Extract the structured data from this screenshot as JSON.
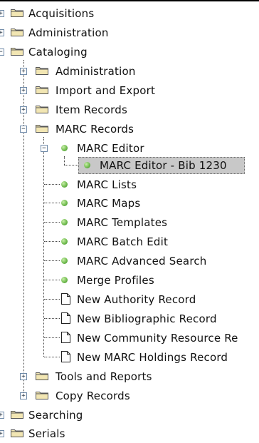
{
  "tree": {
    "items": [
      {
        "label": "Acquisitions",
        "icon": "folder-icon",
        "expander": "+"
      },
      {
        "label": "Administration",
        "icon": "folder-icon",
        "expander": "+"
      },
      {
        "label": "Cataloging",
        "icon": "folder-icon",
        "expander": "-"
      },
      {
        "label": "Administration",
        "icon": "folder-icon",
        "expander": "+"
      },
      {
        "label": "Import and Export",
        "icon": "folder-icon",
        "expander": "+"
      },
      {
        "label": "Item Records",
        "icon": "folder-icon",
        "expander": "+"
      },
      {
        "label": "MARC Records",
        "icon": "folder-icon",
        "expander": "-"
      },
      {
        "label": "MARC Editor",
        "icon": "green-dot-icon",
        "expander": "-"
      },
      {
        "label": "MARC Editor - Bib 1230",
        "icon": "green-dot-icon",
        "selected": true
      },
      {
        "label": "MARC Lists",
        "icon": "green-dot-icon"
      },
      {
        "label": "MARC Maps",
        "icon": "green-dot-icon"
      },
      {
        "label": "MARC Templates",
        "icon": "green-dot-icon"
      },
      {
        "label": "MARC Batch Edit",
        "icon": "green-dot-icon"
      },
      {
        "label": "MARC Advanced Search",
        "icon": "green-dot-icon"
      },
      {
        "label": "Merge Profiles",
        "icon": "green-dot-icon"
      },
      {
        "label": "New Authority Record",
        "icon": "document-icon"
      },
      {
        "label": "New Bibliographic Record",
        "icon": "document-icon"
      },
      {
        "label": "New Community Resource Re",
        "icon": "document-icon"
      },
      {
        "label": "New MARC Holdings Record",
        "icon": "document-icon"
      },
      {
        "label": "Tools and Reports",
        "icon": "folder-icon",
        "expander": "+"
      },
      {
        "label": "Copy Records",
        "icon": "folder-icon",
        "expander": "+"
      },
      {
        "label": "Searching",
        "icon": "folder-icon",
        "expander": "+"
      },
      {
        "label": "Serials",
        "icon": "folder-icon",
        "expander": "+"
      }
    ]
  },
  "colors": {
    "background": "#ffffff",
    "selection": "#c8c8c8",
    "folder": "#d9c98e",
    "leaf_dot": "#6bb84a"
  }
}
